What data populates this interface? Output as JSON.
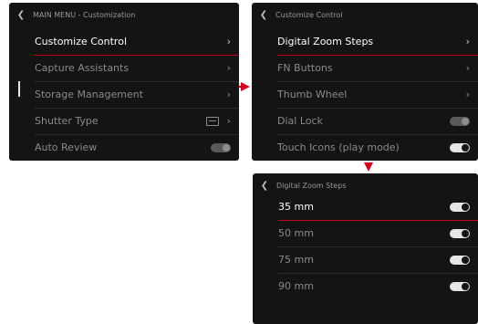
{
  "screen1": {
    "header": "MAIN MENU - Customization",
    "items": [
      {
        "label": "Customize Control"
      },
      {
        "label": "Capture Assistants"
      },
      {
        "label": "Storage Management"
      },
      {
        "label": "Shutter Type"
      },
      {
        "label": "Auto Review",
        "toggle": "off"
      }
    ]
  },
  "screen2": {
    "header": "Customize Control",
    "items": [
      {
        "label": "Digital Zoom Steps"
      },
      {
        "label": "FN Buttons"
      },
      {
        "label": "Thumb Wheel"
      },
      {
        "label": "Dial Lock",
        "toggle": "off"
      },
      {
        "label": "Touch Icons (play mode)",
        "toggle": "on"
      }
    ]
  },
  "screen3": {
    "header": "Digital Zoom Steps",
    "items": [
      {
        "label": "35 mm",
        "toggle": "on"
      },
      {
        "label": "50 mm",
        "toggle": "on"
      },
      {
        "label": "75 mm",
        "toggle": "on"
      },
      {
        "label": "90 mm",
        "toggle": "on"
      }
    ]
  },
  "icons": {
    "back": "chevron-left-icon",
    "next": "chevron-right-icon",
    "shutter": "shutter-type-icon",
    "arrow_right": "red-arrow-right",
    "arrow_down": "red-arrow-down"
  },
  "colors": {
    "accent": "#d5001c",
    "screen_bg": "#141414",
    "selected_text": "#ffffff",
    "text": "#8a8a8a"
  }
}
